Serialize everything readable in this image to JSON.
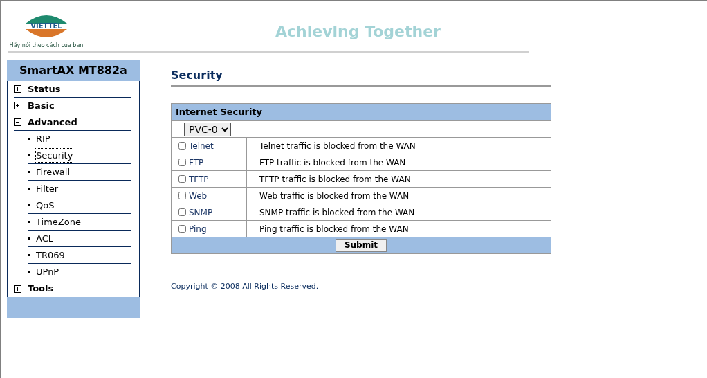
{
  "logo": {
    "wordmark": "VIETTEL",
    "slogan": "Hãy nói theo cách của bạn"
  },
  "tagline": "Achieving Together",
  "sidebar": {
    "title": "SmartAX MT882a",
    "items": [
      {
        "label": "Status",
        "expanded": false
      },
      {
        "label": "Basic",
        "expanded": false
      },
      {
        "label": "Advanced",
        "expanded": true,
        "children": [
          {
            "label": "RIP",
            "selected": false
          },
          {
            "label": "Security",
            "selected": true
          },
          {
            "label": "Firewall",
            "selected": false
          },
          {
            "label": "Filter",
            "selected": false
          },
          {
            "label": "QoS",
            "selected": false
          },
          {
            "label": "TimeZone",
            "selected": false
          },
          {
            "label": "ACL",
            "selected": false
          },
          {
            "label": "TR069",
            "selected": false
          },
          {
            "label": "UPnP",
            "selected": false
          }
        ]
      },
      {
        "label": "Tools",
        "expanded": false
      }
    ]
  },
  "page_title": "Security",
  "panel": {
    "title": "Internet Security",
    "pvc": "PVC-0",
    "rows": [
      {
        "label": "Telnet",
        "checked": false,
        "description": "Telnet traffic is blocked from the WAN"
      },
      {
        "label": "FTP",
        "checked": false,
        "description": "FTP traffic is blocked from the WAN"
      },
      {
        "label": "TFTP",
        "checked": false,
        "description": "TFTP traffic is blocked from the WAN"
      },
      {
        "label": "Web",
        "checked": false,
        "description": "Web traffic is blocked from the WAN"
      },
      {
        "label": "SNMP",
        "checked": false,
        "description": "SNMP traffic is blocked from the WAN"
      },
      {
        "label": "Ping",
        "checked": false,
        "description": "Ping traffic is blocked from the WAN"
      }
    ],
    "submit": "Submit"
  },
  "copyright": "Copyright © 2008 All Rights Reserved."
}
